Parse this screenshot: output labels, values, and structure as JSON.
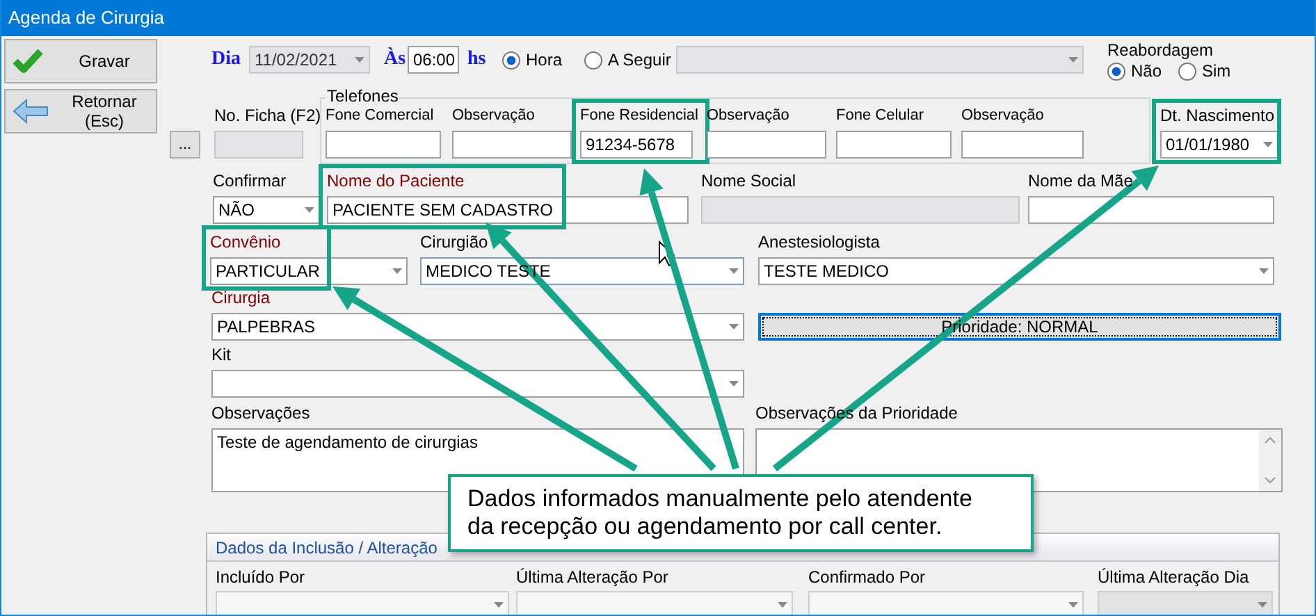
{
  "window": {
    "title": "Agenda de Cirurgia"
  },
  "actions": [
    {
      "kind": "save",
      "label": "Gravar"
    },
    {
      "kind": "back",
      "label": "Retornar (Esc)"
    }
  ],
  "schedule": {
    "day_label": "Dia",
    "date": "11/02/2021",
    "at_label": "Às",
    "time": "06:00",
    "hours_label": "hs",
    "modes": [
      {
        "label": "Hora",
        "selected": true
      },
      {
        "label": "A Seguir",
        "selected": false
      }
    ],
    "queue_combo": {
      "disabled": true
    },
    "reabordagem": {
      "title": "Reabordagem",
      "options": [
        {
          "label": "Não",
          "selected": true
        },
        {
          "label": "Sim",
          "selected": false
        }
      ]
    }
  },
  "rows": [
    {
      "cells": [
        {
          "kind": "button",
          "label": "..."
        },
        {
          "kind": "text",
          "label": "No. Ficha (F2)",
          "required": false,
          "disabled": true,
          "highlighted": false
        },
        {
          "kind": "group",
          "title": "Telefones",
          "fields": [
            {
              "kind": "text",
              "label": "Fone Comercial",
              "required": false,
              "disabled": false,
              "highlighted": false
            },
            {
              "kind": "text",
              "label": "Observação",
              "required": false,
              "disabled": false,
              "highlighted": false
            },
            {
              "kind": "text",
              "label": "Fone Residencial",
              "value": "91234-5678",
              "required": false,
              "disabled": false,
              "highlighted": true
            },
            {
              "kind": "text",
              "label": "Observação",
              "required": false,
              "disabled": false,
              "highlighted": false
            },
            {
              "kind": "text",
              "label": "Fone Celular",
              "required": false,
              "disabled": false,
              "highlighted": false
            },
            {
              "kind": "text",
              "label": "Observação",
              "required": false,
              "disabled": false,
              "highlighted": false
            }
          ]
        },
        {
          "kind": "combo",
          "label": "Dt. Nascimento",
          "value": "01/01/1980",
          "required": false,
          "disabled": false,
          "highlighted": true
        }
      ]
    },
    {
      "cells": [
        {
          "kind": "combo",
          "label": "Confirmar",
          "value": "NÃO",
          "required": false,
          "disabled": false,
          "highlighted": false
        },
        {
          "kind": "text",
          "label": "Nome do Paciente",
          "value": "PACIENTE SEM CADASTRO",
          "required": true,
          "disabled": false,
          "highlighted": true
        },
        {
          "kind": "text",
          "label": "Nome Social",
          "required": false,
          "disabled": true,
          "highlighted": false
        },
        {
          "kind": "text",
          "label": "Nome da Mãe",
          "required": false,
          "disabled": false,
          "highlighted": false
        }
      ]
    },
    {
      "cells": [
        {
          "kind": "combo",
          "label": "Convênio",
          "value": "PARTICULAR",
          "required": true,
          "disabled": false,
          "highlighted": true
        },
        {
          "kind": "combo",
          "label": "Cirurgião",
          "value": "MEDICO TESTE",
          "required": false,
          "disabled": false,
          "highlighted": false
        },
        {
          "kind": "combo",
          "label": "Anestesiologista",
          "value": "TESTE MEDICO",
          "required": false,
          "disabled": false,
          "highlighted": false
        }
      ]
    },
    {
      "cells": [
        {
          "kind": "combo",
          "label": "Cirurgia",
          "value": "PALPEBRAS",
          "required": true,
          "disabled": false,
          "highlighted": false
        },
        {
          "kind": "bar-button",
          "label": "Prioridade: NORMAL",
          "focused": true
        }
      ]
    },
    {
      "cells": [
        {
          "kind": "combo",
          "label": "Kit",
          "required": false,
          "disabled": false,
          "highlighted": false
        }
      ]
    },
    {
      "cells": [
        {
          "kind": "memo",
          "label": "Observações",
          "value": "Teste de agendamento de cirurgias",
          "required": false,
          "disabled": false,
          "highlighted": false,
          "scrollbar": false
        },
        {
          "kind": "memo",
          "label": "Observações da Prioridade",
          "required": false,
          "disabled": false,
          "highlighted": false,
          "scrollbar": true
        }
      ]
    }
  ],
  "audit": {
    "title": "Dados da Inclusão / Alteração",
    "fields": [
      {
        "kind": "combo",
        "label": "Incluído Por",
        "required": false,
        "disabled": false,
        "highlighted": false
      },
      {
        "kind": "combo",
        "label": "Última Alteração Por",
        "required": false,
        "disabled": false,
        "highlighted": false
      },
      {
        "kind": "combo",
        "label": "Confirmado Por",
        "required": false,
        "disabled": false,
        "highlighted": false
      },
      {
        "kind": "combo",
        "label": "Última Alteração Dia",
        "required": false,
        "disabled": true,
        "highlighted": false
      }
    ]
  },
  "annotation": {
    "text": "Dados informados manualmente pelo atendente da recepção ou agendamento por call center."
  }
}
